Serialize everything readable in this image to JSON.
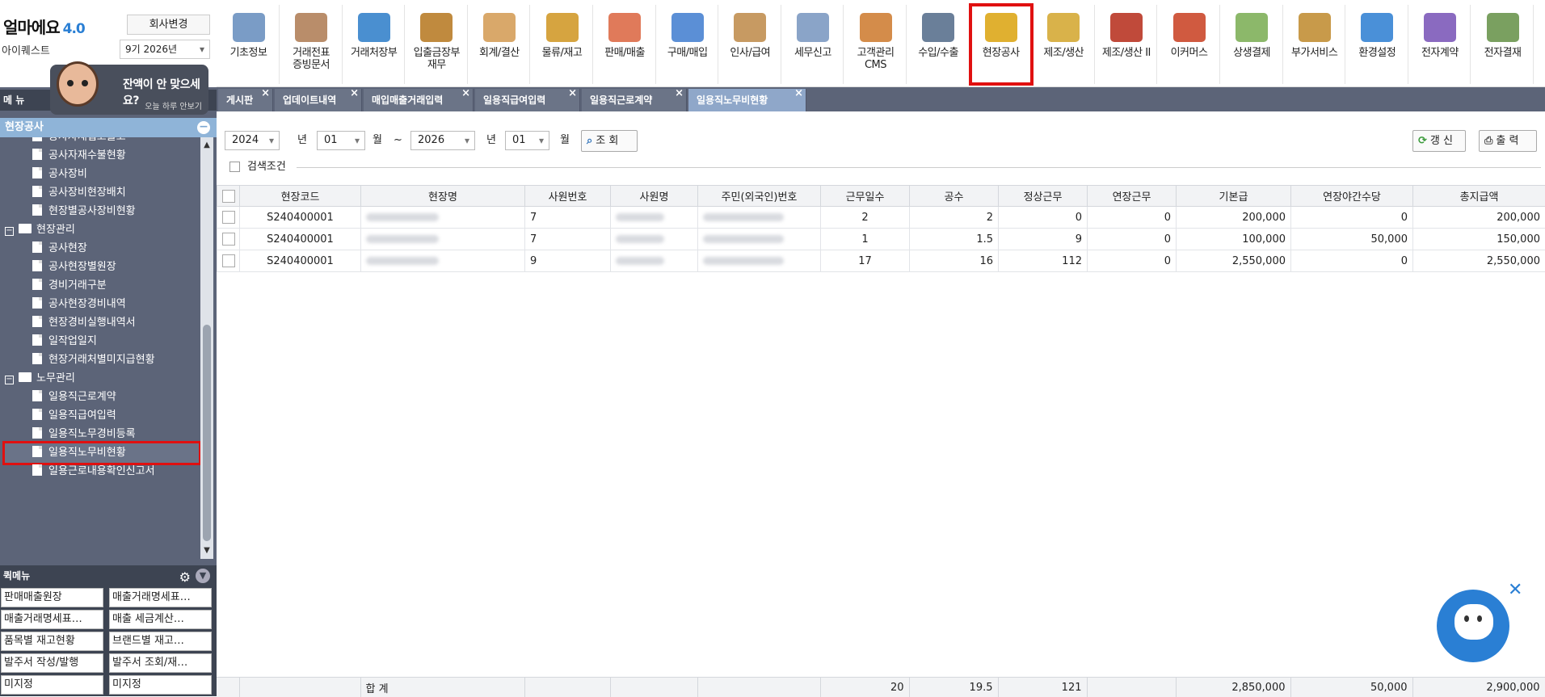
{
  "brand": {
    "name": "얼마에요",
    "version": "4.0",
    "user": "아이퀘스트",
    "change_company": "회사변경",
    "term": "9기 2026년"
  },
  "promo": {
    "title": "잔액이 안 맞으세요?",
    "hide": "오늘 하루 안보기"
  },
  "menu_header": "메 뉴",
  "section": "현장공사",
  "tree": [
    {
      "label": "공사자재입고출고",
      "type": "doc"
    },
    {
      "label": "공사자재수불현황",
      "type": "doc"
    },
    {
      "label": "공사장비",
      "type": "doc"
    },
    {
      "label": "공사장비현장배치",
      "type": "doc"
    },
    {
      "label": "현장별공사장비현황",
      "type": "doc"
    },
    {
      "label": "현장관리",
      "type": "folder"
    },
    {
      "label": "공사현장",
      "type": "doc"
    },
    {
      "label": "공사현장별원장",
      "type": "doc"
    },
    {
      "label": "경비거래구분",
      "type": "doc"
    },
    {
      "label": "공사현장경비내역",
      "type": "doc"
    },
    {
      "label": "현장경비실행내역서",
      "type": "doc"
    },
    {
      "label": "일작업일지",
      "type": "doc"
    },
    {
      "label": "현장거래처별미지급현황",
      "type": "doc"
    },
    {
      "label": "노무관리",
      "type": "folder"
    },
    {
      "label": "일용직근로계약",
      "type": "doc"
    },
    {
      "label": "일용직급여입력",
      "type": "doc"
    },
    {
      "label": "일용직노무경비등록",
      "type": "doc"
    },
    {
      "label": "일용직노무비현황",
      "type": "doc",
      "selected": true
    },
    {
      "label": "일용근로내용확인신고서",
      "type": "doc"
    }
  ],
  "quick": {
    "title": "퀵메뉴",
    "items": [
      "판매매출원장",
      "매출거래명세표…",
      "매출거래명세표…",
      "매출 세금계산…",
      "품목별 재고현황",
      "브랜드별 재고…",
      "발주서 작성/발행",
      "발주서 조회/재…",
      "미지정",
      "미지정"
    ]
  },
  "top_menu": [
    {
      "label": "기초정보",
      "color": "#7a9cc6"
    },
    {
      "label": "거래전표\n증빙문서",
      "color": "#b98d6a"
    },
    {
      "label": "거래처장부",
      "color": "#4a8fd0"
    },
    {
      "label": "입출금장부\n재무",
      "color": "#c08a3e"
    },
    {
      "label": "회계/결산",
      "color": "#d9a86a"
    },
    {
      "label": "물류/재고",
      "color": "#d6a440"
    },
    {
      "label": "판매/매출",
      "color": "#e07a5a"
    },
    {
      "label": "구매/매입",
      "color": "#5b8fd6"
    },
    {
      "label": "인사/급여",
      "color": "#c79a62"
    },
    {
      "label": "세무신고",
      "color": "#8aa4c8"
    },
    {
      "label": "고객관리\nCMS",
      "color": "#d48c4a"
    },
    {
      "label": "수입/수출",
      "color": "#6a7f99"
    },
    {
      "label": "현장공사",
      "color": "#e0b030",
      "selected": true
    },
    {
      "label": "제조/생산",
      "color": "#d9b24a"
    },
    {
      "label": "제조/생산 II",
      "color": "#c04a3a"
    },
    {
      "label": "이커머스",
      "color": "#d05a40"
    },
    {
      "label": "상생결제",
      "color": "#8cb86a"
    },
    {
      "label": "부가서비스",
      "color": "#c89a4a"
    },
    {
      "label": "환경설정",
      "color": "#4a90d8"
    },
    {
      "label": "전자계약",
      "color": "#8a6ac0"
    },
    {
      "label": "전자결재",
      "color": "#7aa060"
    }
  ],
  "tabs": [
    "게시판",
    "업데이트내역",
    "매입매출거래입력",
    "일용직급여입력",
    "일용직근로계약",
    "일용직노무비현황"
  ],
  "search": {
    "year_from": "2024",
    "lbl_year": "년",
    "month_from": "01",
    "lbl_month": "월",
    "tilde": "~",
    "year_to": "2026",
    "lbl_year2": "년",
    "month_to": "01",
    "lbl_month2": "월",
    "query": "조 회",
    "refresh": "갱 신",
    "print": "출 력",
    "cond": "검색조건"
  },
  "table": {
    "headers": [
      "현장코드",
      "현장명",
      "사원번호",
      "사원명",
      "주민(외국인)번호",
      "근무일수",
      "공수",
      "정상근무",
      "연장근무",
      "기본급",
      "연장야간수당",
      "총지급액"
    ],
    "rows": [
      [
        "S240400001",
        "",
        "7",
        "",
        "",
        "2",
        "2",
        "0",
        "0",
        "200,000",
        "0",
        "200,000"
      ],
      [
        "S240400001",
        "",
        "7",
        "",
        "",
        "1",
        "1.5",
        "9",
        "0",
        "100,000",
        "50,000",
        "150,000"
      ],
      [
        "S240400001",
        "",
        "9",
        "",
        "",
        "17",
        "16",
        "112",
        "0",
        "2,550,000",
        "0",
        "2,550,000"
      ]
    ],
    "sum_label": "합 계",
    "sum": [
      "20",
      "19.5",
      "121",
      "",
      "2,850,000",
      "50,000",
      "2,900,000"
    ]
  }
}
